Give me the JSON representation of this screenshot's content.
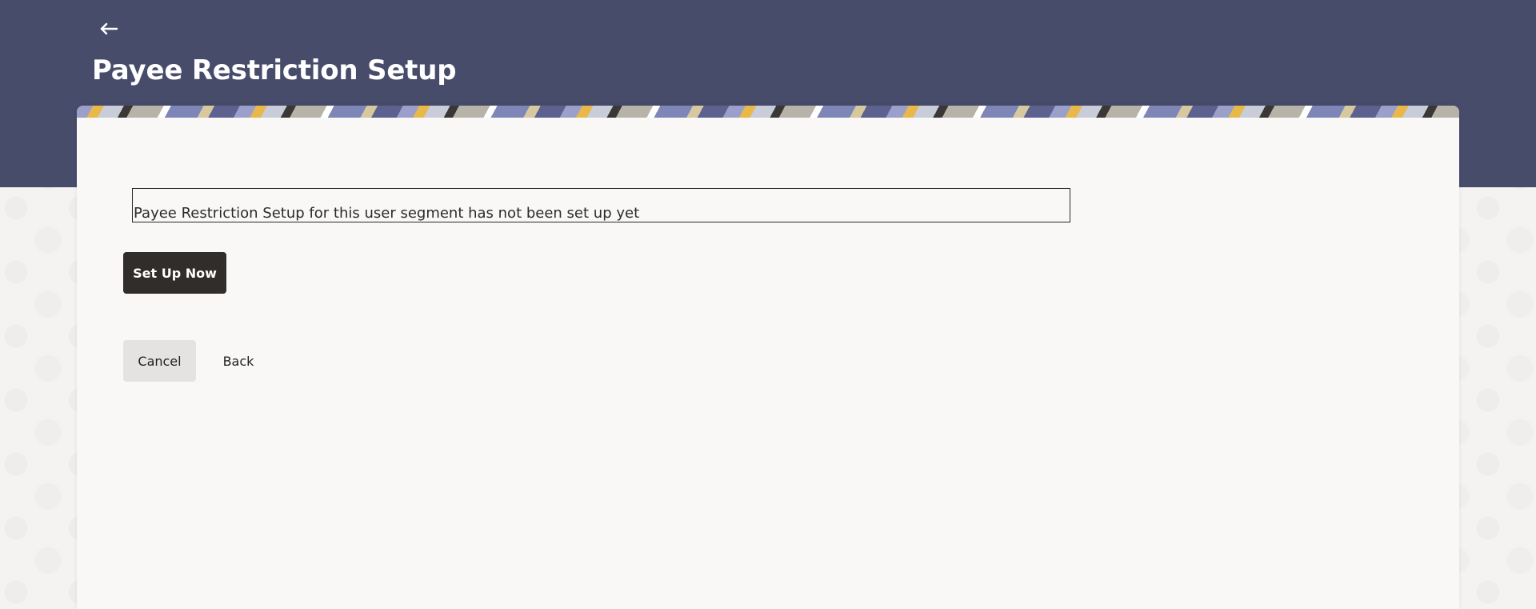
{
  "header": {
    "back_icon": "arrow-left-icon",
    "title": "Payee Restriction Setup"
  },
  "content": {
    "message": "Payee Restriction Setup for this user segment has not been set up yet",
    "setup_button_label": "Set Up Now"
  },
  "actions": {
    "cancel_label": "Cancel",
    "back_label": "Back"
  },
  "colors": {
    "header_background": "#484c6b",
    "primary_button": "#312d2a",
    "secondary_button": "#e4e3e1",
    "card_background": "#f9f8f6"
  }
}
